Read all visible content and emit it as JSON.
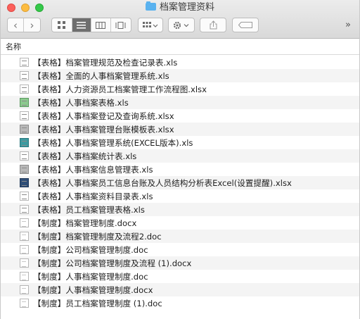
{
  "window": {
    "title": "档案管理资料"
  },
  "toolbar": {
    "back": "‹",
    "forward": "›",
    "overflow": "»"
  },
  "columns": {
    "name": "名称"
  },
  "files": [
    {
      "name": "【表格】档案管理规范及检查记录表.xls",
      "kind": "sheet"
    },
    {
      "name": "【表格】全面的人事档案管理系统.xls",
      "kind": "sheet"
    },
    {
      "name": "【表格】人力资源员工档案管理工作流程图.xlsx",
      "kind": "sheet"
    },
    {
      "name": "【表格】人事档案表格.xls",
      "kind": "sheet"
    },
    {
      "name": "【表格】人事档案登记及查询系统.xlsx",
      "kind": "sheet"
    },
    {
      "name": "【表格】人事档案管理台账模板表.xlsx",
      "kind": "sheet"
    },
    {
      "name": "【表格】人事档案管理系统(EXCEL版本).xls",
      "kind": "sheet"
    },
    {
      "name": "【表格】人事档案统计表.xls",
      "kind": "sheet"
    },
    {
      "name": "【表格】人事档案信息管理表.xls",
      "kind": "sheet"
    },
    {
      "name": "【表格】人事档案员工信息台账及人员结构分析表Excel(设置提醒).xlsx",
      "kind": "sheet"
    },
    {
      "name": "【表格】人事档案资料目录表.xls",
      "kind": "sheet"
    },
    {
      "name": "【表格】员工档案管理表格.xls",
      "kind": "sheet"
    },
    {
      "name": "【制度】档案管理制度.docx",
      "kind": "doc"
    },
    {
      "name": "【制度】档案管理制度及流程2.doc",
      "kind": "doc"
    },
    {
      "name": "【制度】公司档案管理制度.doc",
      "kind": "doc"
    },
    {
      "name": "【制度】公司档案管理制度及流程 (1).docx",
      "kind": "doc"
    },
    {
      "name": "【制度】人事档案管理制度.doc",
      "kind": "doc"
    },
    {
      "name": "【制度】人事档案管理制度.docx",
      "kind": "doc"
    },
    {
      "name": "【制度】员工档案管理制度 (1).doc",
      "kind": "doc"
    }
  ]
}
